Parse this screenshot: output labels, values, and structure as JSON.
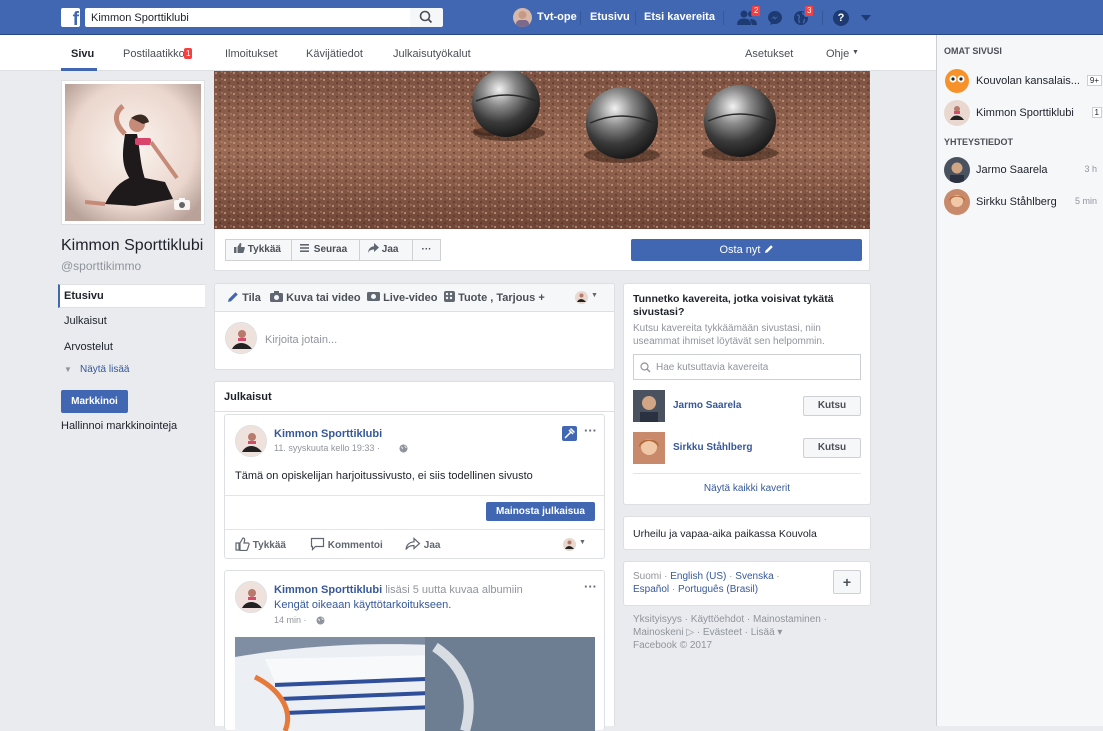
{
  "topbar": {
    "search_value": "Kimmon Sporttiklubi",
    "user_name": "Tvt-ope",
    "home": "Etusivu",
    "find_friends": "Etsi kavereita",
    "friend_requests_badge": "2",
    "notifications_badge": "3"
  },
  "pagenav": {
    "tabs": [
      "Sivu",
      "Postilaatikko",
      "Ilmoitukset",
      "Kävijätiedot",
      "Julkaisutyökalut"
    ],
    "inbox_badge": "1",
    "settings": "Asetukset",
    "help": "Ohje"
  },
  "page": {
    "name": "Kimmon Sporttiklubi",
    "handle": "@sporttikimmo"
  },
  "leftnav": {
    "items": [
      "Etusivu",
      "Julkaisut",
      "Arvostelut"
    ],
    "show_more": "Näytä lisää",
    "promote_btn": "Markkinoi",
    "manage_promotions": "Hallinnoi markkinointeja"
  },
  "cover_actions": {
    "like": "Tykkää",
    "follow": "Seuraa",
    "share": "Jaa",
    "more": "···",
    "shop_now": "Osta nyt"
  },
  "composer": {
    "tabs": [
      "Tila",
      "Kuva tai video",
      "Live-video",
      "Tuote , Tarjous +"
    ],
    "placeholder": "Kirjoita jotain..."
  },
  "posts_header": "Julkaisut",
  "post1": {
    "author": "Kimmon Sporttiklubi",
    "time": "11. syyskuuta kello 19:33 ·",
    "text": "Tämä on opiskelijan harjoitussivusto, ei siis todellinen sivusto",
    "boost": "Mainosta julkaisua",
    "like": "Tykkää",
    "comment": "Kommentoi",
    "share": "Jaa"
  },
  "post2": {
    "author": "Kimmon Sporttiklubi",
    "action": " lisäsi 5 uutta kuvaa albumiin",
    "album": "Kengät oikeaan käyttötarkoitukseen.",
    "time": "14 min ·"
  },
  "invite": {
    "title": "Tunnetko kavereita, jotka voisivat tykätä sivustasi?",
    "desc": "Kutsu kavereita tykkäämään sivustasi, niin useammat ihmiset löytävät sen helpommin.",
    "search_placeholder": "Hae kutsuttavia kavereita",
    "friends": [
      {
        "name": "Jarmo Saarela",
        "btn": "Kutsu"
      },
      {
        "name": "Sirkku Ståhlberg",
        "btn": "Kutsu"
      }
    ],
    "see_all": "Näytä kaikki kaverit"
  },
  "category": "Urheilu ja vapaa-aika paikassa Kouvola",
  "languages": {
    "line1": [
      "Suomi",
      "English (US)",
      "Svenska"
    ],
    "line2": [
      "Español",
      "Português (Brasil)"
    ],
    "add": "+"
  },
  "footer": {
    "line1": "Yksityisyys · Käyttöehdot · Mainostaminen ·",
    "line2": "Mainoskeni ▷ · Evästeet · Lisää ▾",
    "line3": "Facebook © 2017"
  },
  "right_sidebar": {
    "pages_header": "OMAT SIVUSI",
    "pages": [
      {
        "name": "Kouvolan kansalais...",
        "count": "9+"
      },
      {
        "name": "Kimmon Sporttiklubi",
        "count": "1"
      }
    ],
    "contacts_header": "YHTEYSTIEDOT",
    "contacts": [
      {
        "name": "Jarmo Saarela",
        "time": "3 h"
      },
      {
        "name": "Sirkku Ståhlberg",
        "time": "5 min"
      }
    ]
  }
}
